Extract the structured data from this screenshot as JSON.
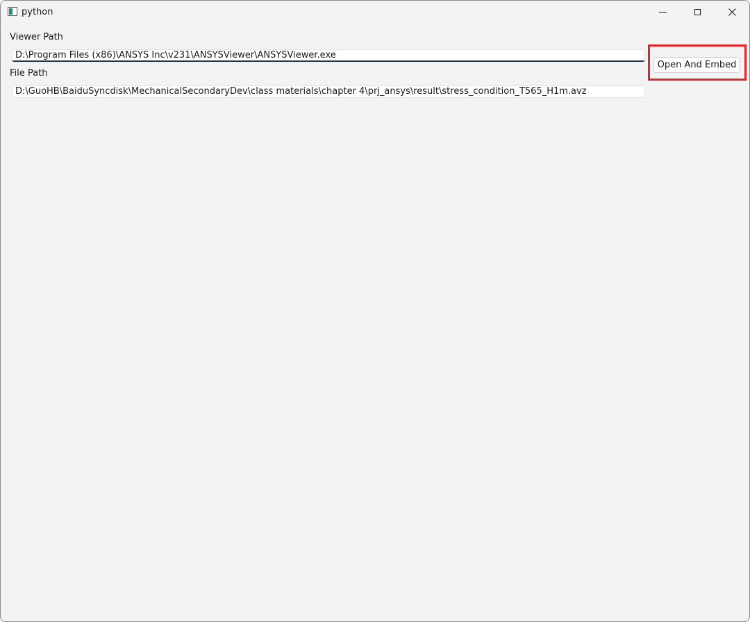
{
  "window": {
    "title": "python",
    "controls": {
      "minimize": "minimize-icon",
      "maximize": "maximize-icon",
      "close": "close-icon"
    }
  },
  "form": {
    "viewer_label": "Viewer Path",
    "viewer_value": "D:\\Program Files (x86)\\ANSYS Inc\\v231\\ANSYSViewer\\ANSYSViewer.exe",
    "file_label": "File Path",
    "file_value": "D:\\GuoHB\\BaiduSyncdisk\\MechanicalSecondaryDev\\class materials\\chapter 4\\prj_ansys\\result\\stress_condition_T565_H1m.avz",
    "open_button_label": "Open And Embed"
  },
  "colors": {
    "window_bg": "#f3f3f3",
    "highlight_border": "#e3242b",
    "focus_underline": "#1e3a4a",
    "app_icon_accent": "#1f8f7a"
  }
}
